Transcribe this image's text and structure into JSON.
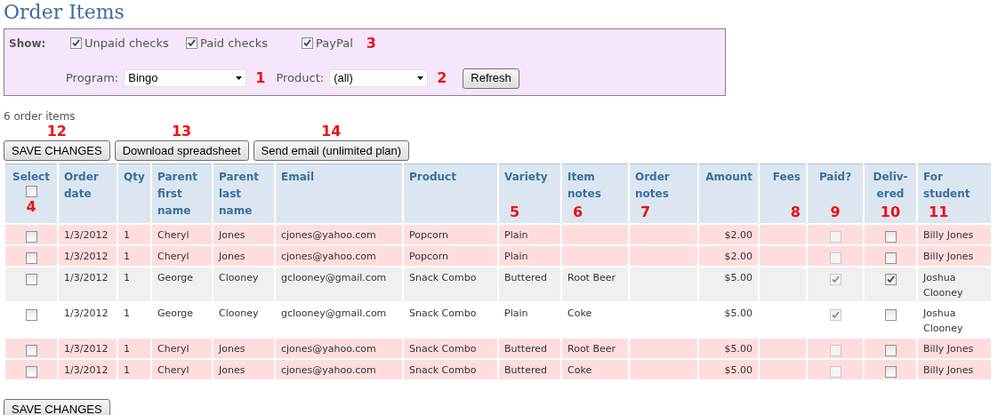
{
  "title": "Order Items",
  "filters": {
    "label": "Show:",
    "checkboxes": [
      {
        "label": "Unpaid checks",
        "checked": true
      },
      {
        "label": "Paid checks",
        "checked": true
      },
      {
        "label": "PayPal",
        "checked": true,
        "marker": "3"
      }
    ],
    "program": {
      "label": "Program:",
      "value": "Bingo",
      "marker": "1"
    },
    "product": {
      "label": "Product:",
      "value": "(all)",
      "marker": "2"
    },
    "refresh": "Refresh"
  },
  "count": "6 order items",
  "actions": [
    {
      "label": "SAVE CHANGES",
      "marker": "12"
    },
    {
      "label": "Download spreadsheet",
      "marker": "13"
    },
    {
      "label": "Send email (unlimited plan)",
      "marker": "14"
    }
  ],
  "table": {
    "select_all": {
      "checked": false,
      "marker": "4"
    },
    "columns": [
      {
        "label": "Select",
        "kind": "check"
      },
      {
        "label": "Order date",
        "kind": "text"
      },
      {
        "label": "Qty",
        "kind": "text"
      },
      {
        "label": "Parent first name",
        "kind": "text"
      },
      {
        "label": "Parent last name",
        "kind": "text"
      },
      {
        "label": "Email",
        "kind": "text"
      },
      {
        "label": "Product",
        "kind": "text"
      },
      {
        "label": "Variety",
        "kind": "text",
        "marker": "5"
      },
      {
        "label": "Item notes",
        "kind": "text",
        "marker": "6"
      },
      {
        "label": "Order notes",
        "kind": "text",
        "marker": "7"
      },
      {
        "label": "Amount",
        "kind": "money"
      },
      {
        "label": "Fees",
        "kind": "money",
        "marker": "8"
      },
      {
        "label": "Paid?",
        "kind": "check",
        "marker": "9"
      },
      {
        "label": "Deliv-ered",
        "kind": "check",
        "marker": "10"
      },
      {
        "label": "For student",
        "kind": "text",
        "marker": "11"
      }
    ],
    "rows": [
      {
        "color": "#ffdddd",
        "cells": [
          {
            "checked": false,
            "disabled": false
          },
          "1/3/2012",
          "1",
          "Cheryl",
          "Jones",
          "cjones@yahoo.com",
          "Popcorn",
          "Plain",
          "",
          "",
          "$2.00",
          "",
          {
            "checked": false,
            "disabled": true
          },
          {
            "checked": false,
            "disabled": false
          },
          "Billy Jones"
        ]
      },
      {
        "color": "#ffdddd",
        "cells": [
          {
            "checked": false,
            "disabled": false
          },
          "1/3/2012",
          "1",
          "Cheryl",
          "Jones",
          "cjones@yahoo.com",
          "Popcorn",
          "Plain",
          "",
          "",
          "$2.00",
          "",
          {
            "checked": false,
            "disabled": true
          },
          {
            "checked": false,
            "disabled": false
          },
          "Billy Jones"
        ]
      },
      {
        "color": "#f0f0f0",
        "cells": [
          {
            "checked": false,
            "disabled": false
          },
          "1/3/2012",
          "1",
          "George",
          "Clooney",
          "gclooney@gmail.com",
          "Snack Combo",
          "Buttered",
          "Root Beer",
          "",
          "$5.00",
          "",
          {
            "checked": true,
            "disabled": true
          },
          {
            "checked": true,
            "disabled": false
          },
          "Joshua Clooney"
        ]
      },
      {
        "color": "#ffffff",
        "cells": [
          {
            "checked": false,
            "disabled": false
          },
          "1/3/2012",
          "1",
          "George",
          "Clooney",
          "gclooney@gmail.com",
          "Snack Combo",
          "Plain",
          "Coke",
          "",
          "$5.00",
          "",
          {
            "checked": true,
            "disabled": true
          },
          {
            "checked": false,
            "disabled": false
          },
          "Joshua Clooney"
        ]
      },
      {
        "color": "#ffdddd",
        "cells": [
          {
            "checked": false,
            "disabled": false
          },
          "1/3/2012",
          "1",
          "Cheryl",
          "Jones",
          "cjones@yahoo.com",
          "Snack Combo",
          "Buttered",
          "Root Beer",
          "",
          "$5.00",
          "",
          {
            "checked": false,
            "disabled": true
          },
          {
            "checked": false,
            "disabled": false
          },
          "Billy Jones"
        ]
      },
      {
        "color": "#ffdddd",
        "cells": [
          {
            "checked": false,
            "disabled": false
          },
          "1/3/2012",
          "1",
          "Cheryl",
          "Jones",
          "cjones@yahoo.com",
          "Snack Combo",
          "Buttered",
          "Coke",
          "",
          "$5.00",
          "",
          {
            "checked": false,
            "disabled": true
          },
          {
            "checked": false,
            "disabled": false
          },
          "Billy Jones"
        ]
      }
    ]
  },
  "footer_button": "SAVE CHANGES"
}
